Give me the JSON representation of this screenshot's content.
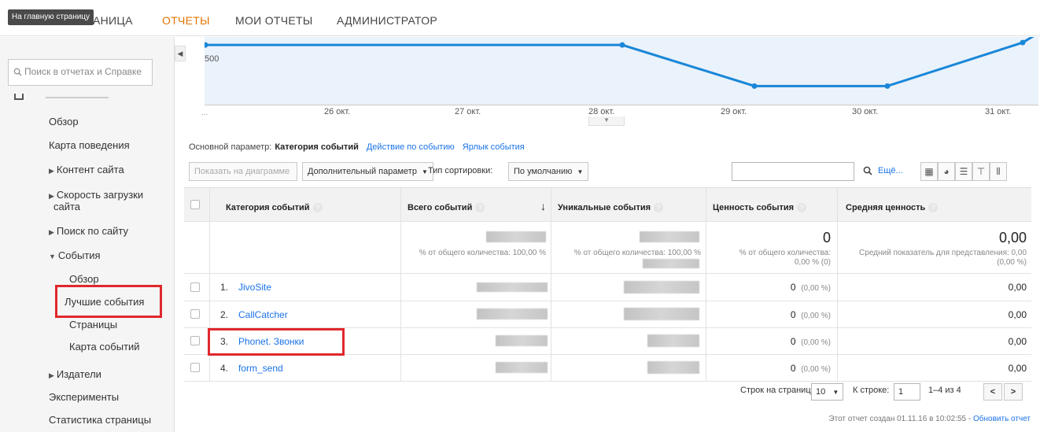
{
  "topnav": {
    "tooltip": "На главную страницу",
    "home_tab_visible": "АНИЦА",
    "tabs": [
      {
        "label": "ОТЧЕТЫ",
        "active": true
      },
      {
        "label": "МОИ ОТЧЕТЫ",
        "active": false
      },
      {
        "label": "АДМИНИСТРАТОР",
        "active": false
      }
    ]
  },
  "sidebar": {
    "search_placeholder": "Поиск в отчетах и Справке",
    "items": [
      {
        "label": "Обзор"
      },
      {
        "label": "Карта поведения"
      },
      {
        "label": "Контент сайта"
      },
      {
        "label": "Скорость загрузки сайта"
      },
      {
        "label": "Поиск по сайту"
      },
      {
        "label": "События"
      },
      {
        "label": "Обзор"
      },
      {
        "label": "Лучшие события"
      },
      {
        "label": "Страницы"
      },
      {
        "label": "Карта событий"
      },
      {
        "label": "Издатели"
      },
      {
        "label": "Эксперименты"
      },
      {
        "label": "Статистика страницы"
      }
    ],
    "speed_line1": "Скорость загрузки",
    "speed_line2": "сайта"
  },
  "chart_data": {
    "type": "line",
    "title": "",
    "y_tick_labels": [
      "500"
    ],
    "x_tick_labels": [
      "...",
      "26 окт.",
      "27 окт.",
      "28 окт.",
      "29 окт.",
      "30 окт.",
      "31 окт."
    ],
    "series": [
      {
        "points": [
          {
            "x": "25 окт.",
            "y": 590
          },
          {
            "x": "28 окт.",
            "y": 590
          },
          {
            "x": "29 окт.",
            "y": 505
          },
          {
            "x": "30 окт.",
            "y": 505
          },
          {
            "x": "31 окт.",
            "y": 595
          }
        ]
      }
    ],
    "line_color": "#1a87d8",
    "fill_color": "#eaf2fb",
    "grid": false
  },
  "dimensions": {
    "label": "Основной параметр:",
    "current": "Категория событий",
    "links": [
      "Действие по событию",
      "Ярлык события"
    ]
  },
  "toolbar": {
    "plot_button": "Показать на диаграмме",
    "secondary_dim": "Дополнительный параметр",
    "sort_label": "Тип сортировки:",
    "sort_value": "По умолчанию",
    "more_link": "Ещё...",
    "search_value": ""
  },
  "table": {
    "headers": [
      "Категория событий",
      "Всего событий",
      "Уникальные события",
      "Ценность события",
      "Средняя ценность"
    ],
    "summary": {
      "total_pct": "% от общего количества: 100,00 %",
      "unique_pct": "% от общего количества: 100,00 %",
      "value_big": "0",
      "value_pct_line1": "% от общего количества:",
      "value_pct_line2": "0,00 % (0)",
      "avg_big": "0,00",
      "avg_line1": "Средний показатель для представления: 0,00",
      "avg_line2": "(0,00 %)"
    },
    "rows": [
      {
        "num": "1.",
        "category": "JivoSite",
        "value": "0",
        "value_pct": "(0,00 %)",
        "avg": "0,00"
      },
      {
        "num": "2.",
        "category": "CallCatcher",
        "value": "0",
        "value_pct": "(0,00 %)",
        "avg": "0,00"
      },
      {
        "num": "3.",
        "category": "Phonet. Звонки",
        "value": "0",
        "value_pct": "(0,00 %)",
        "avg": "0,00"
      },
      {
        "num": "4.",
        "category": "form_send",
        "value": "0",
        "value_pct": "(0,00 %)",
        "avg": "0,00"
      }
    ]
  },
  "footer": {
    "rows_label": "Строк на странице:",
    "rows_value": "10",
    "goto_label": "К строке:",
    "goto_value": "1",
    "range": "1–4 из 4",
    "created_text": "Этот отчет создан 01.11.16 в 10:02:55 -",
    "refresh_link": "Обновить отчет"
  },
  "colors": {
    "accent_orange": "#e37400",
    "link_blue": "#1a73e8",
    "highlight_red": "#e0282d"
  }
}
